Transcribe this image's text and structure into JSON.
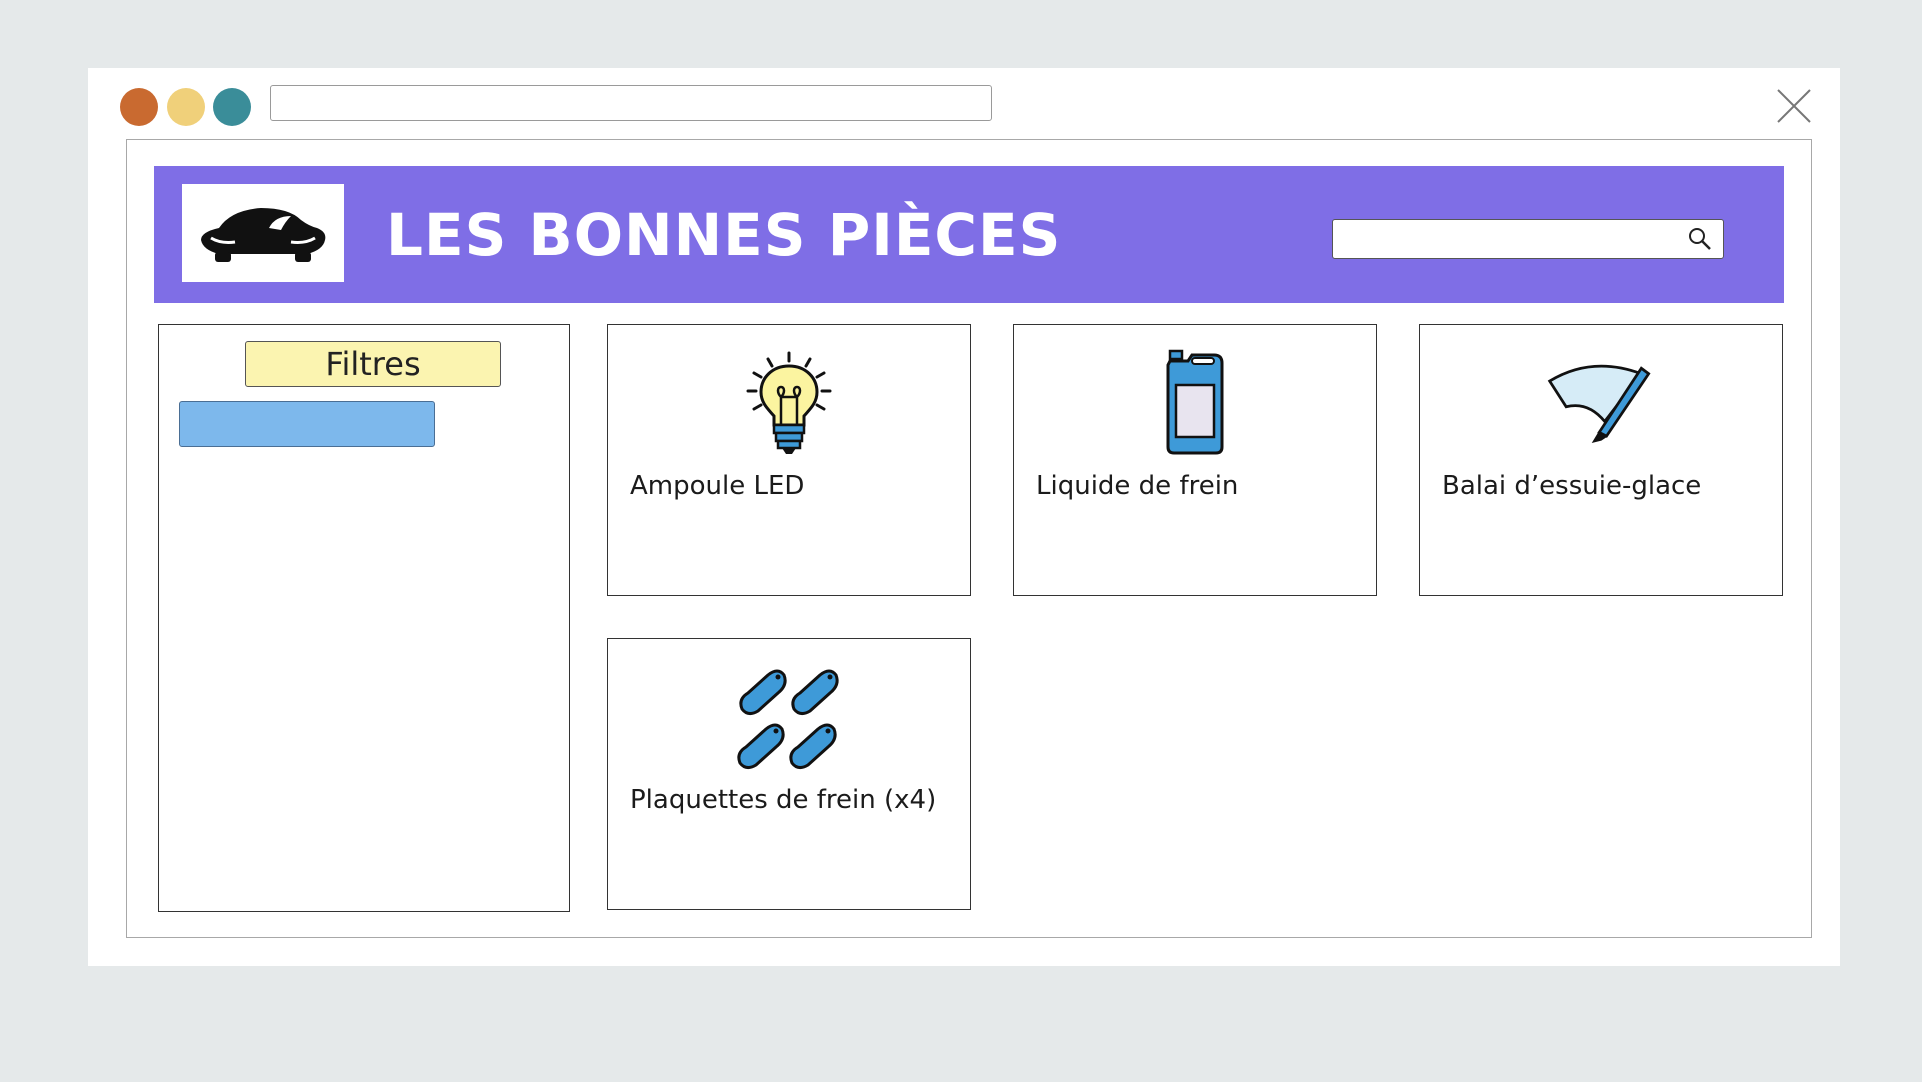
{
  "colors": {
    "traffic_red": "#c96a30",
    "traffic_yellow": "#f0d07a",
    "traffic_green": "#3a8d99",
    "header_bg": "#7f6ee6",
    "filters_title_bg": "#fbf4b0",
    "filter_bar_bg": "#7db8ec",
    "icon_blue": "#3e9ad8"
  },
  "window": {
    "url_value": "",
    "controls": [
      "red-dot",
      "yellow-dot",
      "green-dot"
    ]
  },
  "header": {
    "logo_icon": "car-front-icon",
    "title": "LES BONNES PIÈCES",
    "search_value": "",
    "search_icon": "magnifier-icon"
  },
  "filters": {
    "title": "Filtres",
    "selected_value": ""
  },
  "products": [
    {
      "label": "Ampoule LED",
      "icon": "lightbulb-icon"
    },
    {
      "label": "Liquide de frein",
      "icon": "fluid-bottle-icon"
    },
    {
      "label": "Balai d’essuie-glace",
      "icon": "wiper-blade-icon"
    },
    {
      "label": "Plaquettes de frein (x4)",
      "icon": "brake-pads-icon"
    }
  ]
}
